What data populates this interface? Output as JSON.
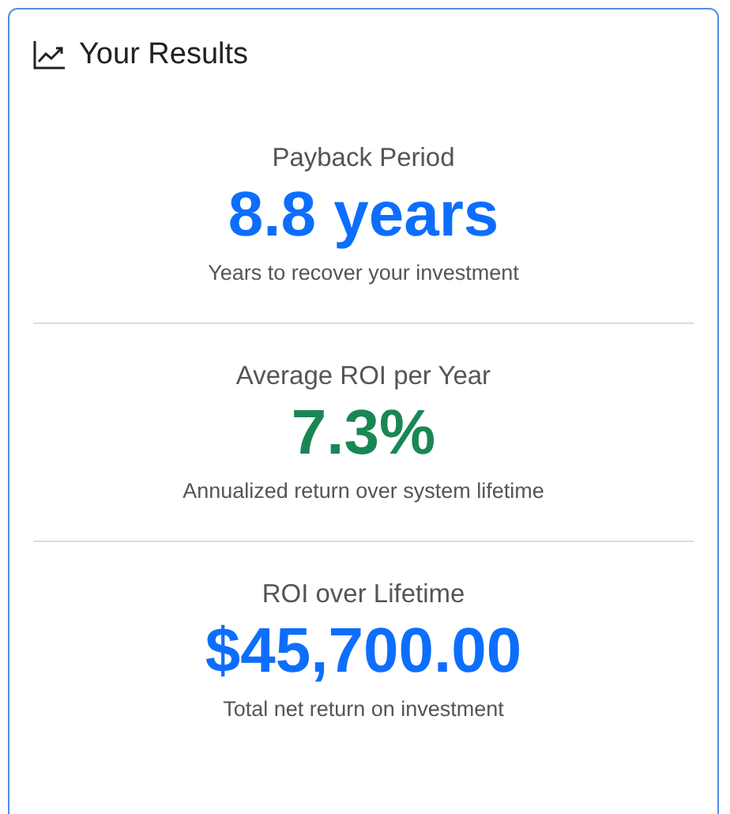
{
  "card": {
    "title": "Your Results"
  },
  "metrics": [
    {
      "label": "Payback Period",
      "value": "8.8 years",
      "description": "Years to recover your investment",
      "color": "#0d6efd"
    },
    {
      "label": "Average ROI per Year",
      "value": "7.3%",
      "description": "Annualized return over system lifetime",
      "color": "#198754"
    },
    {
      "label": "ROI over Lifetime",
      "value": "$45,700.00",
      "description": "Total net return on investment",
      "color": "#0d6efd"
    }
  ]
}
